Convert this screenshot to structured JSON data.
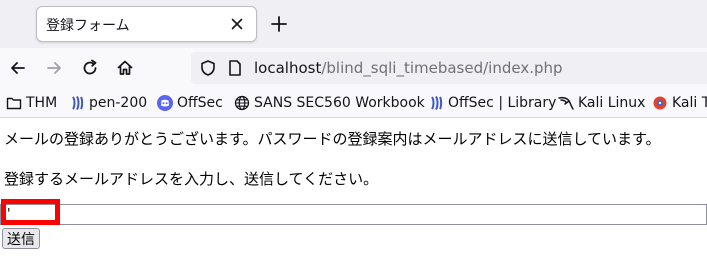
{
  "tab": {
    "title": "登録フォーム"
  },
  "nav": {
    "url_host": "localhost",
    "url_path": "/blind_sqli_timebased/index.php"
  },
  "bookmarks": [
    {
      "label": "THM",
      "icon": "folder-icon"
    },
    {
      "label": "pen-200",
      "icon": "offsec-icon"
    },
    {
      "label": "OffSec",
      "icon": "discord-icon"
    },
    {
      "label": "SANS SEC560 Workbook",
      "icon": "globe-icon"
    },
    {
      "label": "OffSec | Library",
      "icon": "offsec-icon"
    },
    {
      "label": "Kali Linux",
      "icon": "kali-dragon-icon"
    },
    {
      "label": "Kali T",
      "icon": "kali-tools-icon"
    }
  ],
  "page": {
    "message1": "メールの登録ありがとうございます。パスワードの登録案内はメールアドレスに送信しています。",
    "message2": "登録するメールアドレスを入力し、送信してください。",
    "email_value": "'",
    "submit_label": "送信"
  },
  "colors": {
    "highlight": "#ff0000",
    "accent_blue": "#5865f2",
    "tab_strip": "#f0f0f4"
  }
}
